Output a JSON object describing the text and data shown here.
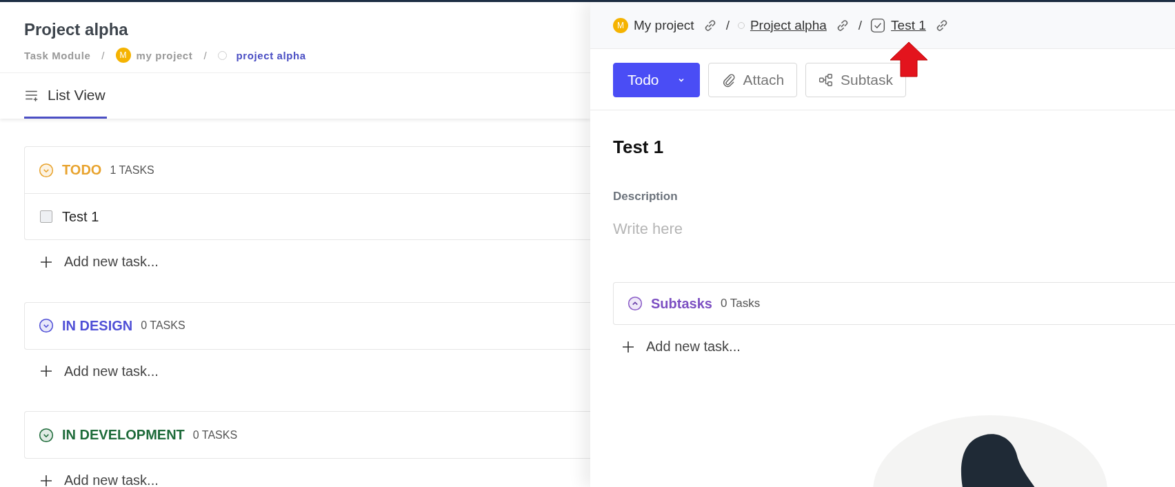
{
  "header": {
    "title": "Project alpha",
    "separator": "/",
    "breadcrumb": [
      {
        "kind": "text",
        "label": "Task Module",
        "current": false
      },
      {
        "kind": "avatar",
        "avatar": "M",
        "label": "my project",
        "current": false
      },
      {
        "kind": "circle",
        "label": "project alpha",
        "current": true
      }
    ]
  },
  "tabs": [
    {
      "label": "List View",
      "selected": true
    }
  ],
  "groups": [
    {
      "name": "TODO",
      "count": "1 TASKS",
      "color": "#e8a32e",
      "tasks": [
        {
          "title": "Test 1",
          "checked": false
        }
      ],
      "add_label": "Add new task..."
    },
    {
      "name": "IN DESIGN",
      "count": "0 TASKS",
      "color": "#4f4fd6",
      "add_label": "Add new task..."
    },
    {
      "name": "IN DEVELOPMENT",
      "count": "0 TASKS",
      "color": "#1e6b3a",
      "add_label": "Add new task..."
    }
  ],
  "detail": {
    "separator": "/",
    "breadcrumb": [
      {
        "kind": "avatar",
        "avatar": "M",
        "label": "My project",
        "underlined": false
      },
      {
        "kind": "circle",
        "label": "Project alpha",
        "underlined": true
      },
      {
        "kind": "checkbox",
        "label": "Test 1",
        "underlined": true
      }
    ],
    "actions": [
      {
        "kind": "status",
        "label": "Todo"
      },
      {
        "kind": "attach",
        "label": "Attach"
      },
      {
        "kind": "subtask",
        "label": "Subtask"
      }
    ],
    "title": "Test 1",
    "description": {
      "label": "Description",
      "placeholder": "Write here"
    },
    "subtasks": {
      "label": "Subtasks",
      "count": "0 Tasks",
      "expanded": true,
      "add_label": "Add new task..."
    }
  }
}
